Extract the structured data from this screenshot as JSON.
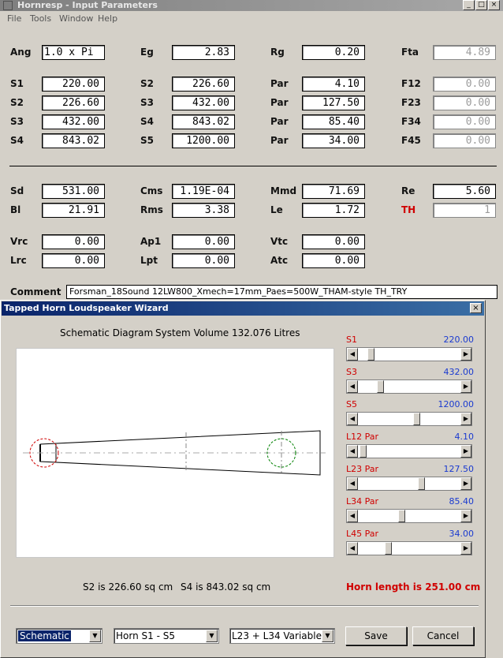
{
  "window": {
    "title": "Hornresp - Input Parameters",
    "min_glyph": "_",
    "max_glyph": "□",
    "close_glyph": "×"
  },
  "menu": [
    "File",
    "Tools",
    "Window",
    "Help"
  ],
  "params": {
    "ang": {
      "label": "Ang",
      "value": "1.0 x Pi"
    },
    "eg": {
      "label": "Eg",
      "value": "2.83"
    },
    "rg": {
      "label": "Rg",
      "value": "0.20"
    },
    "fta": {
      "label": "Fta",
      "value": "4.89"
    },
    "rows": [
      {
        "s_label": "S1",
        "s_value": "220.00",
        "s2_label": "S2",
        "s2_value": "226.60",
        "par_label": "Par",
        "par_value": "4.10",
        "f_label": "F12",
        "f_value": "0.00"
      },
      {
        "s_label": "S2",
        "s_value": "226.60",
        "s2_label": "S3",
        "s2_value": "432.00",
        "par_label": "Par",
        "par_value": "127.50",
        "f_label": "F23",
        "f_value": "0.00"
      },
      {
        "s_label": "S3",
        "s_value": "432.00",
        "s2_label": "S4",
        "s2_value": "843.02",
        "par_label": "Par",
        "par_value": "85.40",
        "f_label": "F34",
        "f_value": "0.00"
      },
      {
        "s_label": "S4",
        "s_value": "843.02",
        "s2_label": "S5",
        "s2_value": "1200.00",
        "par_label": "Par",
        "par_value": "34.00",
        "f_label": "F45",
        "f_value": "0.00"
      }
    ],
    "sd": {
      "label": "Sd",
      "value": "531.00"
    },
    "cms": {
      "label": "Cms",
      "value": "1.19E-04"
    },
    "mmd": {
      "label": "Mmd",
      "value": "71.69"
    },
    "re": {
      "label": "Re",
      "value": "5.60"
    },
    "bl": {
      "label": "Bl",
      "value": "21.91"
    },
    "rms": {
      "label": "Rms",
      "value": "3.38"
    },
    "le": {
      "label": "Le",
      "value": "1.72"
    },
    "th": {
      "label": "TH",
      "value": "1"
    },
    "vrc": {
      "label": "Vrc",
      "value": "0.00"
    },
    "ap1": {
      "label": "Ap1",
      "value": "0.00"
    },
    "vtc": {
      "label": "Vtc",
      "value": "0.00"
    },
    "lrc": {
      "label": "Lrc",
      "value": "0.00"
    },
    "lpt": {
      "label": "Lpt",
      "value": "0.00"
    },
    "atc": {
      "label": "Atc",
      "value": "0.00"
    },
    "comment": {
      "label": "Comment",
      "value": "Forsman_18Sound 12LW800_Xmech=17mm_Paes=500W_THAM-style TH_TRY"
    }
  },
  "wizard": {
    "title": "Tapped Horn Loudspeaker Wizard",
    "close_glyph": "×",
    "diagram_label": "Schematic Diagram",
    "system_volume": "System Volume 132.076 Litres",
    "sliders": [
      {
        "name": "S1",
        "par": "",
        "value": "220.00",
        "position": 0.1
      },
      {
        "name": "S3",
        "par": "",
        "value": "432.00",
        "position": 0.2
      },
      {
        "name": "S5",
        "par": "",
        "value": "1200.00",
        "position": 0.58
      },
      {
        "name": "L12",
        "par": "Par",
        "value": "4.10",
        "position": 0.02
      },
      {
        "name": "L23",
        "par": "Par",
        "value": "127.50",
        "position": 0.63
      },
      {
        "name": "L34",
        "par": "Par",
        "value": "85.40",
        "position": 0.42
      },
      {
        "name": "L45",
        "par": "Par",
        "value": "34.00",
        "position": 0.28
      }
    ],
    "s2_info": "S2 is 226.60 sq cm",
    "s4_info": "S4 is 843.02 sq cm",
    "horn_length": "Horn length is 251.00 cm",
    "combo_view": "Schematic",
    "combo_horn": "Horn S1 - S5",
    "combo_variable": "L23 + L34 Variable",
    "save_label": "Save",
    "cancel_label": "Cancel",
    "arrow_left": "◀",
    "arrow_right": "▶",
    "arrow_down": "▼"
  },
  "colors": {
    "label_red": "#d00000",
    "value_blue": "#1a3ad0",
    "dialog_title": "#0a246a"
  }
}
